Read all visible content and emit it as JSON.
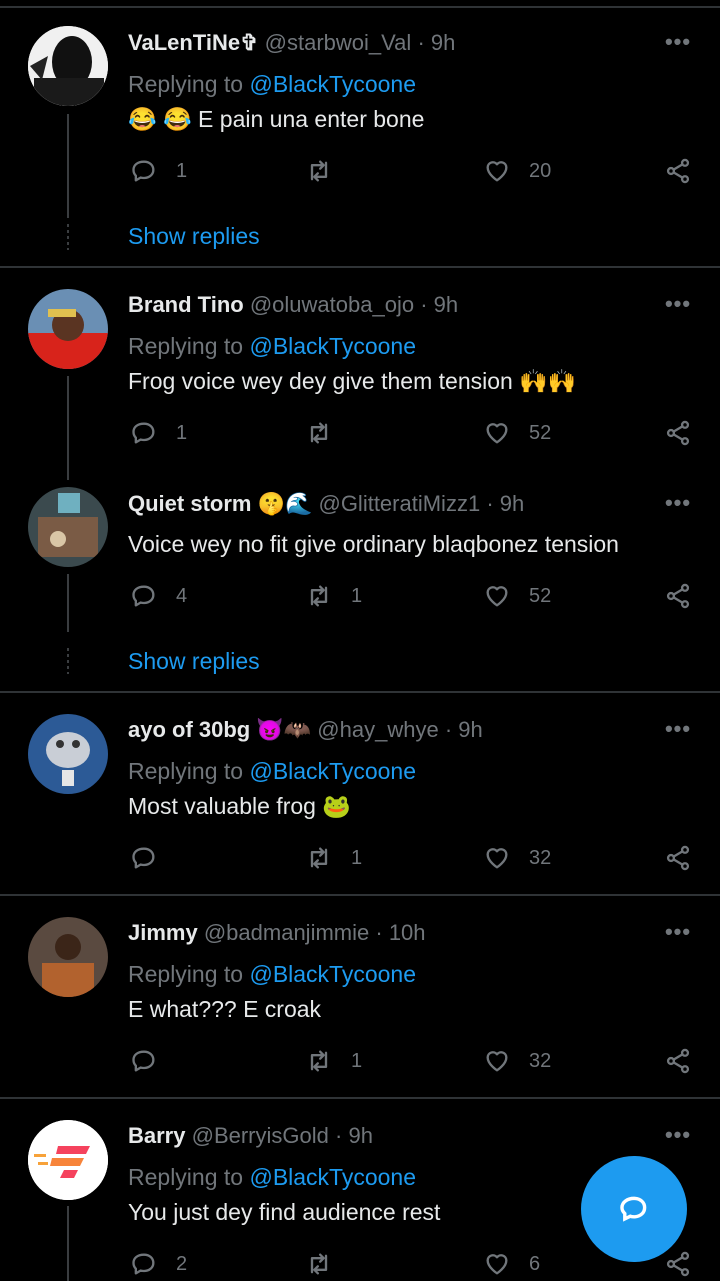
{
  "tweets": [
    {
      "name": "VaLenTiNe✞",
      "handle": "@starbwoi_Val",
      "time": "9h",
      "replying_prefix": "Replying to ",
      "replying_to": "@BlackTycoone",
      "text": "😂 😂 E pain una enter bone",
      "replies": "1",
      "retweets": "",
      "likes": "20",
      "show_replies": "Show replies"
    },
    {
      "name": "Brand Tino",
      "handle": "@oluwatoba_ojo",
      "time": "9h",
      "replying_prefix": "Replying to ",
      "replying_to": "@BlackTycoone",
      "text": "Frog voice wey dey give them tension 🙌🙌",
      "replies": "1",
      "retweets": "",
      "likes": "52"
    },
    {
      "name": "Quiet storm 🤫🌊",
      "handle": "@GlitteratiMizz1",
      "time": "9h",
      "text": "Voice wey no fit give ordinary blaqbonez tension",
      "replies": "4",
      "retweets": "1",
      "likes": "52",
      "show_replies": "Show replies"
    },
    {
      "name": "ayo of 30bg 😈🦇",
      "handle": "@hay_whye",
      "time": "9h",
      "replying_prefix": "Replying to ",
      "replying_to": "@BlackTycoone",
      "text": "Most valuable frog 🐸",
      "replies": "",
      "retweets": "1",
      "likes": "32"
    },
    {
      "name": "Jimmy",
      "handle": "@badmanjimmie",
      "time": "10h",
      "replying_prefix": "Replying to ",
      "replying_to": "@BlackTycoone",
      "text": "E what??? E croak",
      "replies": "",
      "retweets": "1",
      "likes": "32"
    },
    {
      "name": "Barry",
      "handle": "@BerryisGold",
      "time": "9h",
      "replying_prefix": "Replying to ",
      "replying_to": "@BlackTycoone",
      "text": "You just dey find audience rest",
      "replies": "2",
      "retweets": "",
      "likes": "6"
    }
  ],
  "separator": "·",
  "more_glyph": "•••",
  "icons": [
    "reply-icon",
    "retweet-icon",
    "like-icon",
    "share-icon",
    "more-icon",
    "compose-reply-icon"
  ],
  "colors": {
    "background": "#000000",
    "link": "#1d9bf0",
    "muted": "#71767b",
    "text": "#e7e9ea",
    "divider": "#2f3336"
  }
}
